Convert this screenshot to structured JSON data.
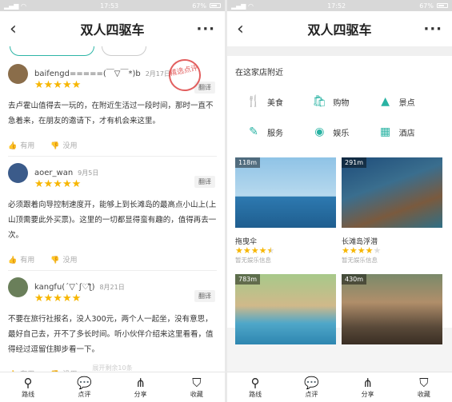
{
  "left": {
    "status_time": "17:53",
    "battery": "67%",
    "title": "双人四驱车",
    "chips": [
      "",
      ""
    ],
    "reviews": [
      {
        "user": "baifengd=====(￣▽￣*)b",
        "date": "2月17日",
        "stars": "★★★★★",
        "translate": "翻译",
        "stamp": "精选点评",
        "text": "去卢霍山值得去一玩的，在附近生活过一段时间，那时一直不急着来，在朋友的邀请下，才有机会来这里。",
        "useful": "有用",
        "useless": "没用",
        "avatar": "#8a6d4a"
      },
      {
        "user": "aoer_wan",
        "date": "9月5日",
        "stars": "★★★★★",
        "translate": "翻译",
        "text": "必须跟着向导控制速度开，能够上到长滩岛的最高点小山上(上山顶需要此外买票)。这里的一切都显得蛮有趣的，值得再去一次。",
        "useful": "有用",
        "useless": "没用",
        "avatar": "#3b5b8a"
      },
      {
        "user": "kangfu(´▽`ʃ♡ƪ)",
        "date": "8月21日",
        "stars": "★★★★★",
        "translate": "翻译",
        "text": "不要在旅行社报名，没人300元，两个人一起坐，没有意思，最好自己去，开不了多长时间。听小伙伴介绍来这里看看，值得经过逗留住脚步看一下。",
        "useful": "有用",
        "useless": "没用",
        "avatar": "#6a7f5a"
      }
    ],
    "faded": "展开剩余10条",
    "tabs": [
      {
        "icon": "route-icon",
        "label": "路线",
        "glyph": "⚲"
      },
      {
        "icon": "comment-icon",
        "label": "点评",
        "glyph": "💬"
      },
      {
        "icon": "share-icon",
        "label": "分享",
        "glyph": "⋔"
      },
      {
        "icon": "bookmark-icon",
        "label": "收藏",
        "glyph": "⛉"
      }
    ]
  },
  "right": {
    "status_time": "17:52",
    "battery": "67%",
    "title": "双人四驱车",
    "nearby_title": "在这家店附近",
    "categories": [
      {
        "label": "美食",
        "glyph": "🍴"
      },
      {
        "label": "购物",
        "glyph": "🛍"
      },
      {
        "label": "景点",
        "glyph": "▲"
      },
      {
        "label": "服务",
        "glyph": "✎"
      },
      {
        "label": "娱乐",
        "glyph": "◉"
      },
      {
        "label": "酒店",
        "glyph": "▦"
      }
    ],
    "pois": [
      {
        "distance": "118m",
        "name": "拖曳伞",
        "rating": 4.5,
        "status": "暂无娱乐信息"
      },
      {
        "distance": "291m",
        "name": "长滩岛浮潜",
        "rating": 4,
        "status": "暂无娱乐信息"
      },
      {
        "distance": "783m",
        "name": "",
        "rating": 0,
        "status": ""
      },
      {
        "distance": "430m",
        "name": "",
        "rating": 0,
        "status": ""
      }
    ],
    "tabs": [
      {
        "icon": "route-icon",
        "label": "路线"
      },
      {
        "icon": "comment-icon",
        "label": "点评"
      },
      {
        "icon": "share-icon",
        "label": "分享"
      },
      {
        "icon": "bookmark-icon",
        "label": "收藏"
      }
    ]
  }
}
